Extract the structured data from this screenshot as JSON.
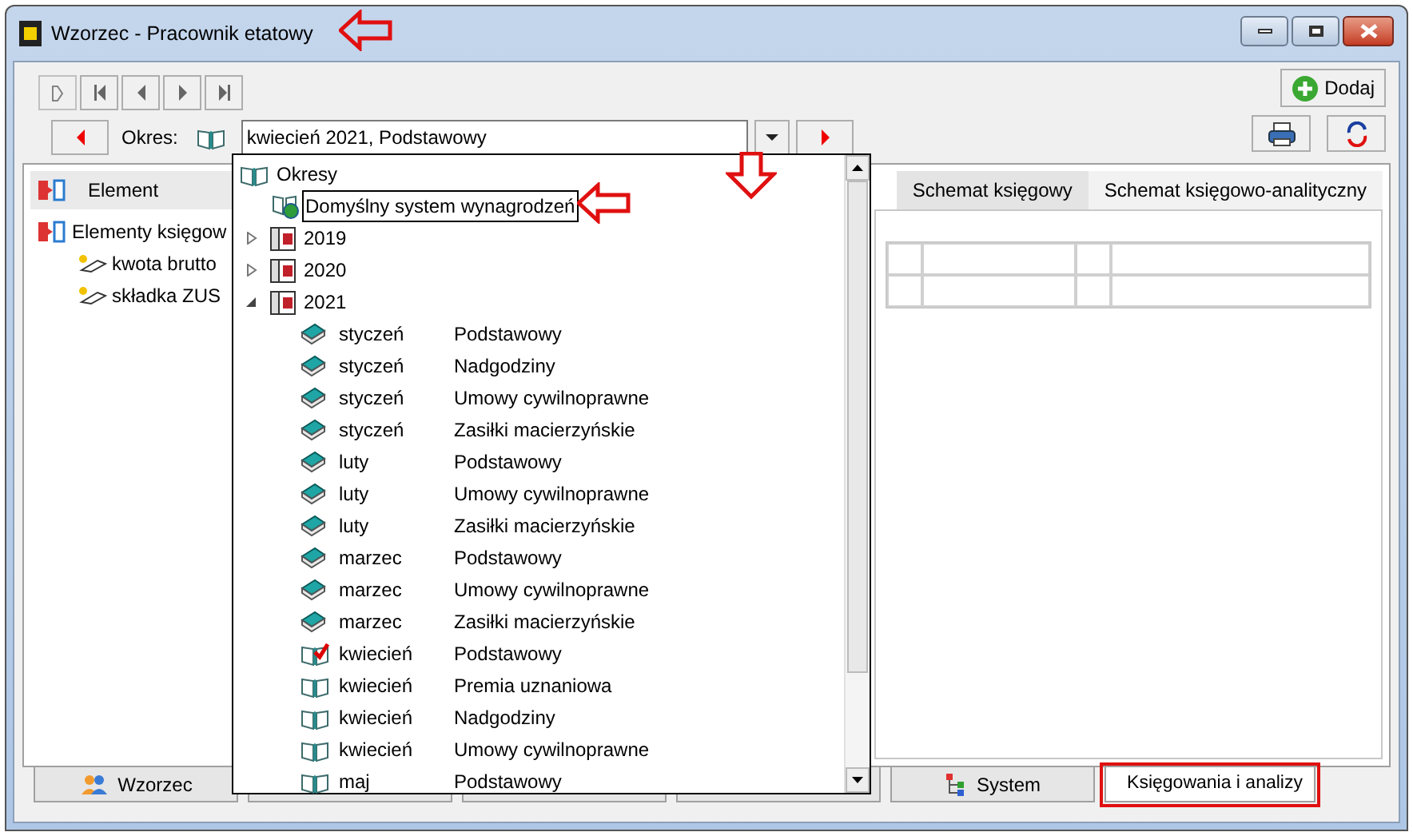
{
  "window": {
    "title": "Wzorzec - Pracownik etatowy"
  },
  "toolbar": {
    "add_button": "Dodaj",
    "period_label": "Okres:",
    "period_value": "kwiecień 2021, Podstawowy"
  },
  "elements_panel": {
    "header": "Element",
    "tree": [
      {
        "label": "Elementy księgow",
        "children": [
          {
            "label": "kwota brutto"
          },
          {
            "label": "składka ZUS"
          }
        ]
      }
    ]
  },
  "schema_tabs": [
    {
      "label": "Schemat księgowy",
      "selected": false
    },
    {
      "label": "Schemat księgowo-analityczny",
      "selected": true
    }
  ],
  "period_dropdown": {
    "root": "Okresy",
    "items": [
      {
        "label": "Domyślny system wynagrodzeń",
        "kind": "default",
        "focused": true
      },
      {
        "label": "2019",
        "kind": "year",
        "expanded": false
      },
      {
        "label": "2020",
        "kind": "year",
        "expanded": false
      },
      {
        "label": "2021",
        "kind": "year",
        "expanded": true,
        "children": [
          {
            "month": "styczeń",
            "type": "Podstawowy",
            "kind": "closed"
          },
          {
            "month": "styczeń",
            "type": "Nadgodziny",
            "kind": "closed"
          },
          {
            "month": "styczeń",
            "type": "Umowy cywilnoprawne",
            "kind": "closed"
          },
          {
            "month": "styczeń",
            "type": "Zasiłki macierzyńskie",
            "kind": "closed"
          },
          {
            "month": "luty",
            "type": "Podstawowy",
            "kind": "closed"
          },
          {
            "month": "luty",
            "type": "Umowy cywilnoprawne",
            "kind": "closed"
          },
          {
            "month": "luty",
            "type": "Zasiłki macierzyńskie",
            "kind": "closed"
          },
          {
            "month": "marzec",
            "type": "Podstawowy",
            "kind": "closed"
          },
          {
            "month": "marzec",
            "type": "Umowy cywilnoprawne",
            "kind": "closed"
          },
          {
            "month": "marzec",
            "type": "Zasiłki macierzyńskie",
            "kind": "closed"
          },
          {
            "month": "kwiecień",
            "type": "Podstawowy",
            "kind": "current"
          },
          {
            "month": "kwiecień",
            "type": "Premia uznaniowa",
            "kind": "open"
          },
          {
            "month": "kwiecień",
            "type": "Nadgodziny",
            "kind": "open"
          },
          {
            "month": "kwiecień",
            "type": "Umowy cywilnoprawne",
            "kind": "open"
          },
          {
            "month": "maj",
            "type": "Podstawowy",
            "kind": "open"
          }
        ]
      }
    ]
  },
  "bottom_tabs": [
    {
      "label": "Wzorzec",
      "kind": "template",
      "selected": false
    },
    {
      "kind": "blank",
      "selected": false
    },
    {
      "kind": "blank",
      "selected": false
    },
    {
      "kind": "blank",
      "selected": false
    },
    {
      "label": "System",
      "kind": "system",
      "selected": false
    },
    {
      "label": "Księgowania i analizy",
      "kind": "accounting",
      "selected": true,
      "highlighted": true
    }
  ]
}
